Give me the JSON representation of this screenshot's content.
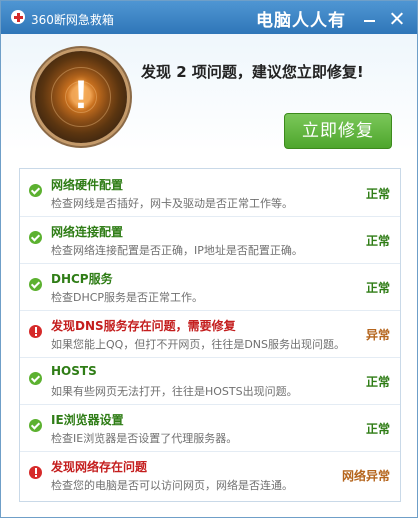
{
  "titlebar": {
    "app_title": "360断网急救箱",
    "watermark": "电脑人人有"
  },
  "header": {
    "headline": "发现 2 项问题，建议您立即修复!",
    "alert_symbol": "!",
    "repair_button": "立即修复"
  },
  "checks": [
    {
      "title": "网络硬件配置",
      "desc": "检查网线是否插好，网卡及驱动是否正常工作等。",
      "status": "正常",
      "state": "ok"
    },
    {
      "title": "网络连接配置",
      "desc": "检查网络连接配置是否正确，IP地址是否配置正确。",
      "status": "正常",
      "state": "ok"
    },
    {
      "title": "DHCP服务",
      "desc": "检查DHCP服务是否正常工作。",
      "status": "正常",
      "state": "ok"
    },
    {
      "title": "发现DNS服务存在问题，需要修复",
      "desc": "如果您能上QQ，但打不开网页，往往是DNS服务出现问题。",
      "status": "异常",
      "state": "error"
    },
    {
      "title": "HOSTS",
      "desc": "如果有些网页无法打开，往往是HOSTS出现问题。",
      "status": "正常",
      "state": "ok"
    },
    {
      "title": "IE浏览器设置",
      "desc": "检查IE浏览器是否设置了代理服务器。",
      "status": "正常",
      "state": "ok"
    },
    {
      "title": "发现网络存在问题",
      "desc": "检查您的电脑是否可以访问网页，网络是否连通。",
      "status": "网络异常",
      "state": "error"
    }
  ],
  "colors": {
    "ok": "#2f7d16",
    "error": "#c41e1e",
    "accent": "#4ea62c",
    "titlebar": "#2f76b8"
  }
}
